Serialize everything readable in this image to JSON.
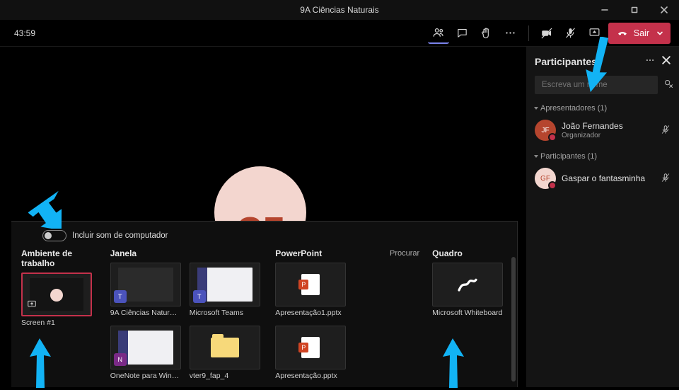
{
  "window": {
    "title": "9A Ciências Naturais"
  },
  "toolbar": {
    "timer": "43:59",
    "leave_label": "Sair"
  },
  "panel": {
    "title": "Participantes",
    "search_placeholder": "Escreva um nome",
    "presenters_header": "Apresentadores (1)",
    "presenter": {
      "name": "João Fernandes",
      "role": "Organizador",
      "initials": "JF"
    },
    "attendees_header": "Participantes (1)",
    "attendee": {
      "name": "Gaspar o fantasminha",
      "initials": "GF"
    }
  },
  "stage": {
    "avatar_initials": "GF"
  },
  "share": {
    "toggle_label": "Incluir som de computador",
    "col_desktop": "Ambiente de trabalho",
    "col_window": "Janela",
    "col_ppt": "PowerPoint",
    "col_ppt_browse": "Procurar",
    "col_board": "Quadro",
    "items": {
      "screen1": "Screen #1",
      "win1": "9A Ciências Naturais | Mi...",
      "win2": "Microsoft Teams",
      "win3": "OneNote para Windows ...",
      "win4": "vter9_fap_4",
      "ppt1": "Apresentação1.pptx",
      "ppt2": "Apresentação.pptx",
      "wb": "Microsoft Whiteboard"
    }
  }
}
